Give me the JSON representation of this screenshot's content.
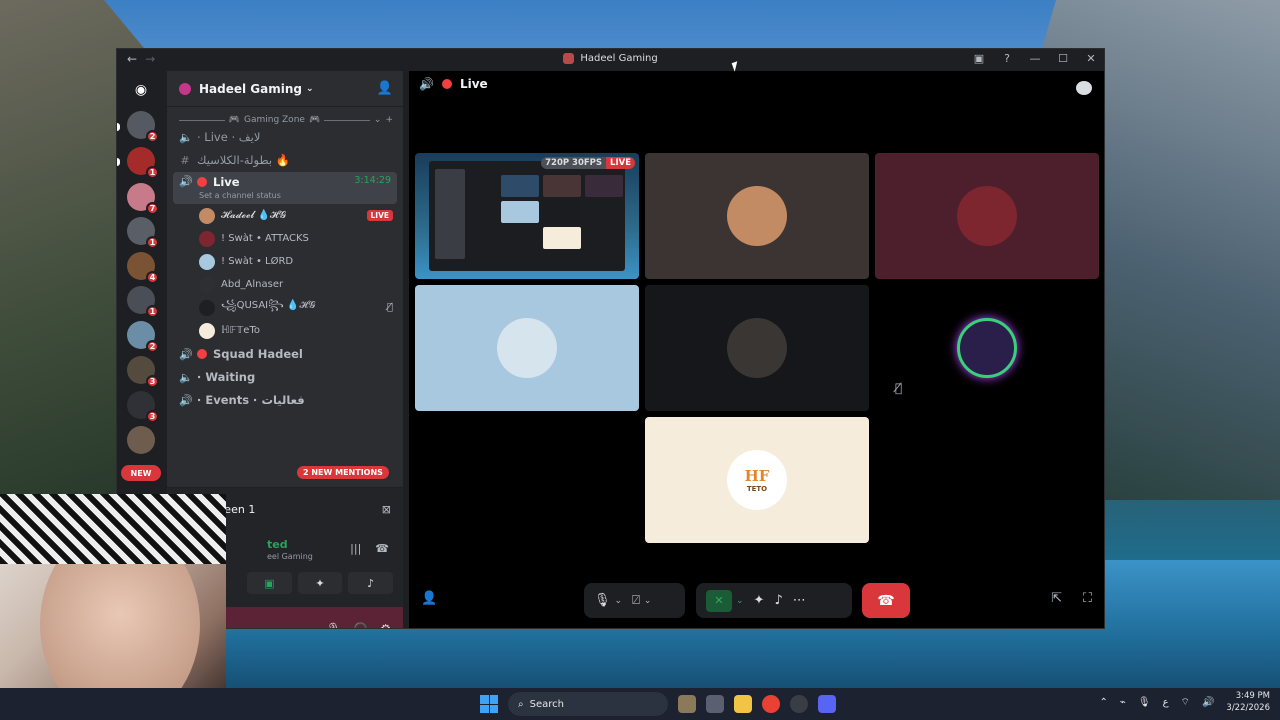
{
  "window": {
    "title": "Hadeel Gaming",
    "back_icon": "←",
    "forward_icon": "→"
  },
  "rail": {
    "badges": [
      "2",
      "1",
      "7",
      "1",
      "4",
      "1",
      "2",
      "3",
      "3"
    ],
    "new_label": "NEW"
  },
  "sidebar": {
    "server_name": "Hadeel Gaming",
    "category": "Gaming Zone",
    "channels": [
      {
        "label": "⋅ Live ⋅ لايف"
      },
      {
        "label": "بطولة-الكلاسيك 🔥"
      },
      {
        "label": "Live",
        "time": "3:14:29",
        "status": "Set a channel status"
      }
    ],
    "users": [
      {
        "name": "𝓗𝓪𝓭𝓮𝓮𝓵 💧𝓗𝓖",
        "badge": "LIVE"
      },
      {
        "name": "! Swàt • ATTACKS"
      },
      {
        "name": "! Swàt • LØRD"
      },
      {
        "name": "Abd_Alnaser"
      },
      {
        "name": "꧁QUSAI꧂ 💧𝓗𝓖"
      },
      {
        "name": "ℍ𝔽𝕋eTo"
      }
    ],
    "more_channels": [
      "Squad Hadeel",
      "⋅ Waiting",
      "⋅ Events ⋅ فعاليات"
    ],
    "mentions_pill": "2 NEW MENTIONS"
  },
  "voice_panel": {
    "screen_label": "Screen 1",
    "status": "ted",
    "server": "eel Gaming",
    "userbar_text": "creen"
  },
  "stage": {
    "channel_name": "Live",
    "stream_res": "720P 30FPS",
    "live_badge": "LIVE",
    "tiles": [
      {
        "type": "screen"
      },
      {
        "color": "#3b3433",
        "avatar": "#c28b64"
      },
      {
        "color": "#4d1f2c",
        "avatar": "#7d2630"
      },
      {
        "color": "#a8c8e0",
        "avatar": "#d6e4ee"
      },
      {
        "color": "#16171a",
        "avatar": "#3a3634"
      },
      {
        "color": "#000000",
        "avatar": "#2a1e4a"
      },
      {
        "color": "#f5ecdc",
        "avatar": "#ffffff",
        "text": "HF",
        "sub": "TETO"
      }
    ]
  },
  "taskbar": {
    "search_label": "Search",
    "time": "3:49 PM",
    "date": "3/22/2026"
  },
  "colors": {
    "discord_red": "#da373c",
    "discord_green": "#23a55a",
    "bg_dark": "#1e1f22"
  }
}
